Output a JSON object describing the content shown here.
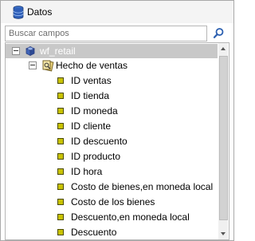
{
  "header": {
    "title": "Datos",
    "icon": "database-icon"
  },
  "search": {
    "placeholder": "Buscar campos",
    "icon": "search-icon"
  },
  "tree": {
    "root": {
      "label": "wf_retail",
      "icon": "cube-icon",
      "expanded": true
    },
    "group": {
      "label": "Hecho de ventas",
      "icon": "fact-table-icon",
      "expanded": true
    },
    "items": [
      "ID ventas",
      "ID tienda",
      "ID moneda",
      "ID cliente",
      "ID descuento",
      "ID producto",
      "ID hora",
      "Costo de bienes,en moneda local",
      "Costo de los bienes",
      "Descuento,en moneda local",
      "Descuento"
    ]
  },
  "colors": {
    "item_marker": "#c9c300",
    "root_highlight": "#c8c8c8"
  }
}
